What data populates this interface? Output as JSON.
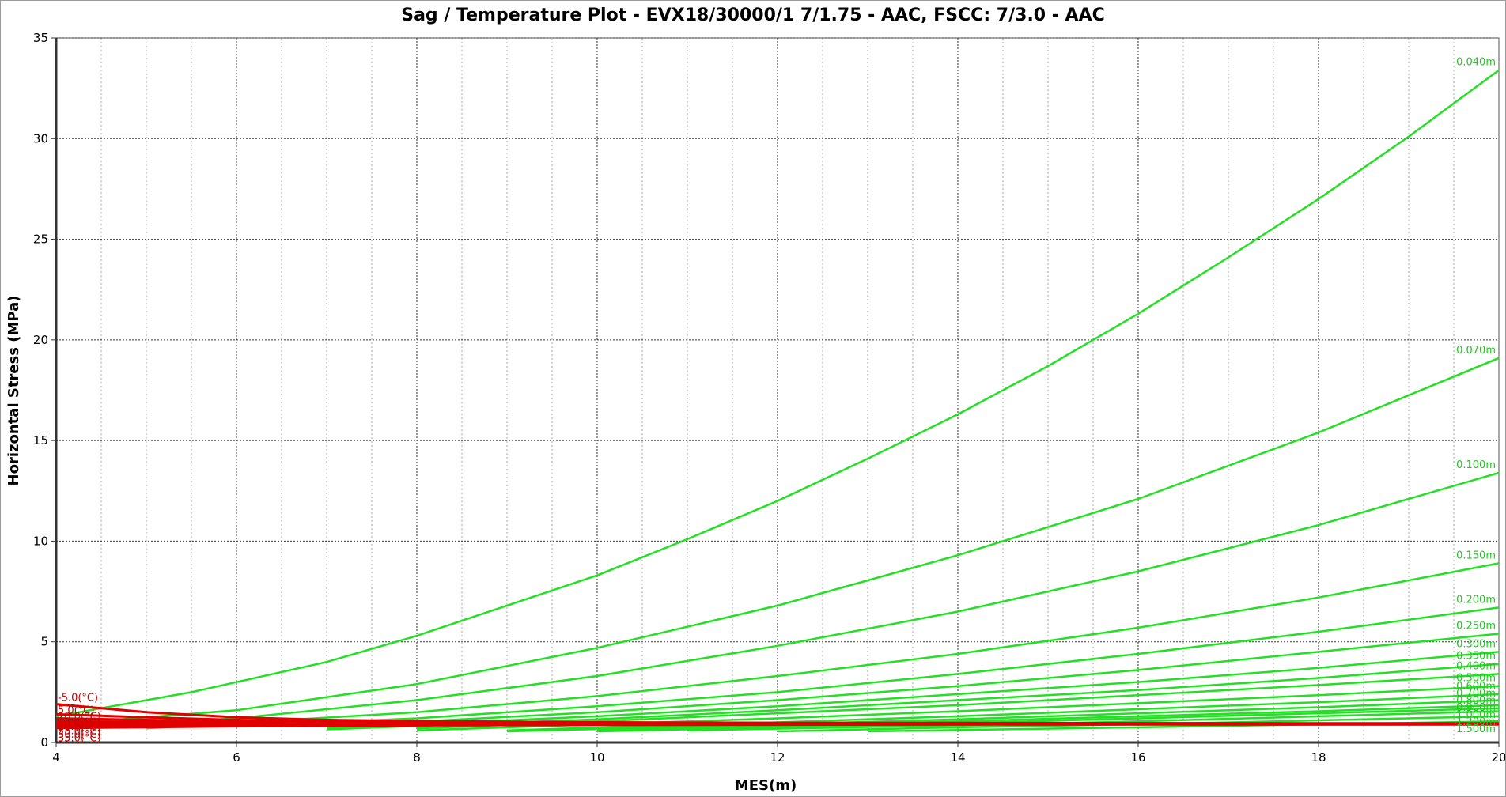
{
  "chart_data": {
    "type": "line",
    "title": "Sag / Temperature Plot - EVX18/30000/1   7/1.75 - AAC,  FSCC: 7/3.0 - AAC",
    "xlabel": "MES(m)",
    "ylabel": "Horizontal Stress (MPa)",
    "xlim": [
      4,
      20
    ],
    "ylim": [
      0,
      35
    ],
    "xticks": [
      4,
      6,
      8,
      10,
      12,
      14,
      16,
      18,
      20
    ],
    "yticks": [
      0,
      5,
      10,
      15,
      20,
      25,
      30,
      35
    ],
    "grid": true,
    "colors": {
      "sag_lines": "#22e022",
      "temperature_lines": "#e00000"
    },
    "sag_series": [
      {
        "name": "0.040m",
        "x": [
          4,
          5.5,
          7,
          8,
          9,
          10,
          11,
          12,
          13,
          14,
          15,
          16,
          17,
          18,
          19,
          20
        ],
        "y": [
          1.3,
          2.5,
          4.0,
          5.3,
          6.8,
          8.3,
          10.1,
          12.0,
          14.1,
          16.3,
          18.7,
          21.3,
          24.1,
          27.0,
          30.1,
          33.4
        ]
      },
      {
        "name": "0.070m",
        "x": [
          4,
          6,
          8,
          10,
          12,
          14,
          16,
          18,
          20
        ],
        "y": [
          0.9,
          1.6,
          2.9,
          4.7,
          6.8,
          9.3,
          12.1,
          15.4,
          19.1
        ]
      },
      {
        "name": "0.100m",
        "x": [
          4,
          6,
          8,
          10,
          12,
          14,
          16,
          18,
          20
        ],
        "y": [
          0.7,
          1.2,
          2.1,
          3.3,
          4.8,
          6.5,
          8.5,
          10.8,
          13.4
        ]
      },
      {
        "name": "0.150m",
        "x": [
          5,
          8,
          10,
          12,
          14,
          16,
          18,
          20
        ],
        "y": [
          0.7,
          1.5,
          2.3,
          3.3,
          4.4,
          5.7,
          7.2,
          8.9
        ]
      },
      {
        "name": "0.200m",
        "x": [
          6,
          8,
          10,
          12,
          14,
          16,
          18,
          20
        ],
        "y": [
          0.8,
          1.2,
          1.8,
          2.5,
          3.4,
          4.4,
          5.5,
          6.7
        ]
      },
      {
        "name": "0.250m",
        "x": [
          7,
          10,
          12,
          14,
          16,
          18,
          20
        ],
        "y": [
          0.8,
          1.5,
          2.1,
          2.8,
          3.6,
          4.5,
          5.4
        ]
      },
      {
        "name": "0.300m",
        "x": [
          7,
          10,
          12,
          14,
          16,
          18,
          20
        ],
        "y": [
          0.7,
          1.3,
          1.8,
          2.4,
          3.0,
          3.7,
          4.5
        ]
      },
      {
        "name": "0.350m",
        "x": [
          7,
          10,
          12,
          14,
          16,
          18,
          20
        ],
        "y": [
          0.65,
          1.15,
          1.6,
          2.1,
          2.6,
          3.2,
          3.9
        ]
      },
      {
        "name": "0.400m",
        "x": [
          8,
          10,
          12,
          14,
          16,
          18,
          20
        ],
        "y": [
          0.7,
          1.05,
          1.45,
          1.85,
          2.35,
          2.85,
          3.4
        ]
      },
      {
        "name": "0.500m",
        "x": [
          8,
          10,
          12,
          14,
          16,
          18,
          20
        ],
        "y": [
          0.6,
          0.9,
          1.2,
          1.55,
          1.95,
          2.35,
          2.8
        ]
      },
      {
        "name": "0.600m",
        "x": [
          9,
          12,
          14,
          16,
          18,
          20
        ],
        "y": [
          0.6,
          1.0,
          1.3,
          1.65,
          2.0,
          2.4
        ]
      },
      {
        "name": "0.700m",
        "x": [
          9,
          12,
          14,
          16,
          18,
          20
        ],
        "y": [
          0.55,
          0.9,
          1.15,
          1.45,
          1.75,
          2.1
        ]
      },
      {
        "name": "0.800m",
        "x": [
          10,
          12,
          14,
          16,
          18,
          20
        ],
        "y": [
          0.6,
          0.8,
          1.05,
          1.3,
          1.55,
          1.85
        ]
      },
      {
        "name": "0.900m",
        "x": [
          10,
          12,
          14,
          16,
          18,
          20
        ],
        "y": [
          0.55,
          0.75,
          0.95,
          1.2,
          1.45,
          1.7
        ]
      },
      {
        "name": "1.000m",
        "x": [
          11,
          14,
          16,
          18,
          20
        ],
        "y": [
          0.6,
          0.85,
          1.05,
          1.3,
          1.55
        ]
      },
      {
        "name": "1.200m",
        "x": [
          12,
          14,
          16,
          18,
          20
        ],
        "y": [
          0.55,
          0.75,
          0.9,
          1.1,
          1.3
        ]
      },
      {
        "name": "1.500m",
        "x": [
          13,
          16,
          18,
          20
        ],
        "y": [
          0.55,
          0.75,
          0.9,
          1.05
        ]
      }
    ],
    "temperature_series": [
      {
        "name": "-5.0(°C)",
        "x": [
          4,
          5,
          6,
          7,
          8,
          10,
          12,
          14,
          16,
          18,
          20
        ],
        "y": [
          1.9,
          1.5,
          1.25,
          1.12,
          1.06,
          1.0,
          0.98,
          0.97,
          0.96,
          0.95,
          0.95
        ]
      },
      {
        "name": "5.0(°C)",
        "x": [
          4,
          5,
          6,
          7,
          8,
          10,
          12,
          14,
          16,
          18,
          20
        ],
        "y": [
          1.4,
          1.25,
          1.12,
          1.05,
          1.01,
          0.97,
          0.96,
          0.95,
          0.95,
          0.94,
          0.94
        ]
      },
      {
        "name": "10.0(°C)",
        "x": [
          4,
          5,
          6,
          7,
          8,
          10,
          12,
          14,
          16,
          18,
          20
        ],
        "y": [
          1.2,
          1.12,
          1.05,
          1.01,
          0.98,
          0.96,
          0.95,
          0.94,
          0.94,
          0.93,
          0.93
        ]
      },
      {
        "name": "15.0(°C)",
        "x": [
          4,
          5,
          6,
          7,
          8,
          10,
          12,
          14,
          16,
          18,
          20
        ],
        "y": [
          1.05,
          1.02,
          0.99,
          0.97,
          0.96,
          0.94,
          0.93,
          0.93,
          0.93,
          0.93,
          0.93
        ]
      },
      {
        "name": "20.0(°C)",
        "x": [
          4,
          5,
          6,
          7,
          8,
          10,
          12,
          14,
          16,
          18,
          20
        ],
        "y": [
          0.95,
          0.94,
          0.93,
          0.93,
          0.93,
          0.92,
          0.92,
          0.92,
          0.92,
          0.92,
          0.92
        ]
      },
      {
        "name": "25.0(°C)",
        "x": [
          4,
          5,
          6,
          7,
          8,
          10,
          12,
          14,
          16,
          18,
          20
        ],
        "y": [
          0.85,
          0.87,
          0.88,
          0.89,
          0.9,
          0.9,
          0.91,
          0.91,
          0.91,
          0.91,
          0.91
        ]
      },
      {
        "name": "30.0(°C)",
        "x": [
          4,
          5,
          6,
          7,
          8,
          10,
          12,
          14,
          16,
          18,
          20
        ],
        "y": [
          0.78,
          0.81,
          0.84,
          0.86,
          0.87,
          0.88,
          0.89,
          0.9,
          0.9,
          0.9,
          0.9
        ]
      },
      {
        "name": "35.0(°C)",
        "x": [
          4,
          5,
          6,
          7,
          8,
          10,
          12,
          14,
          16,
          18,
          20
        ],
        "y": [
          0.72,
          0.76,
          0.8,
          0.83,
          0.85,
          0.87,
          0.88,
          0.89,
          0.89,
          0.89,
          0.9
        ]
      }
    ]
  }
}
